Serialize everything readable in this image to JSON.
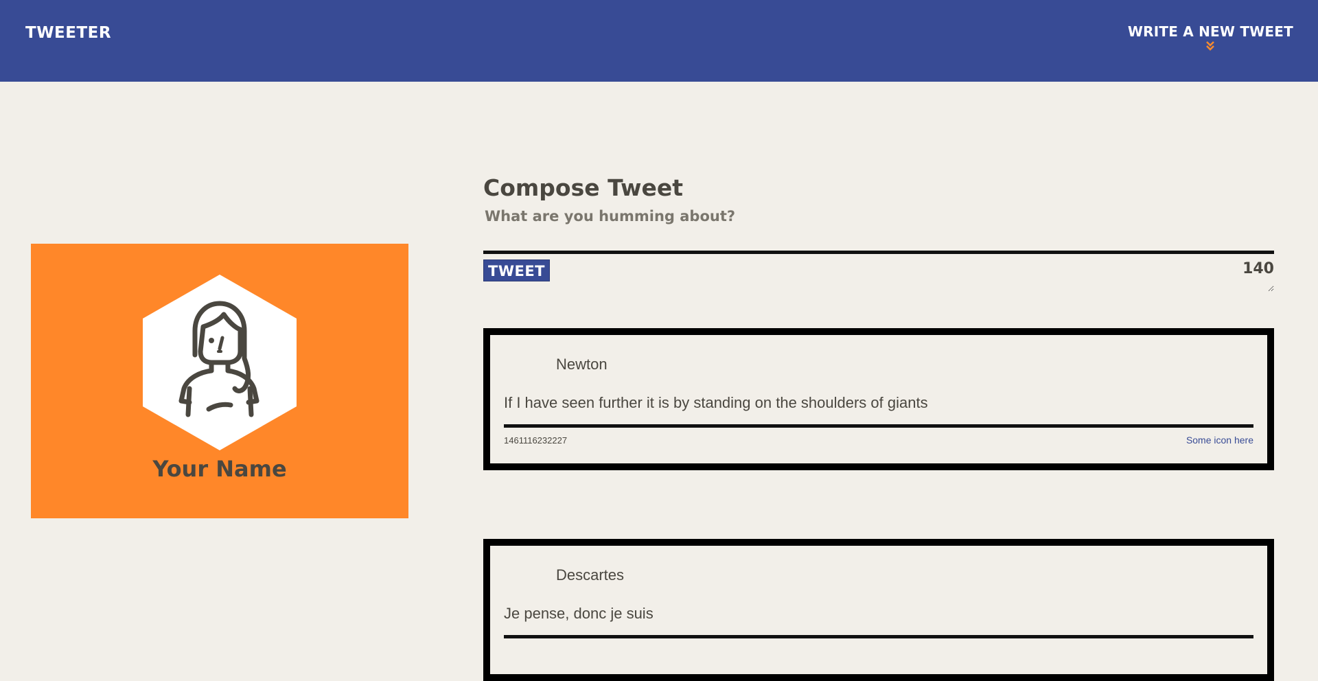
{
  "nav": {
    "brand": "TWEETER",
    "compose_toggle_label": "WRITE A NEW TWEET",
    "compose_toggle_icon": "double-chevron-down-icon"
  },
  "profile": {
    "name": "Your Name",
    "avatar_icon": "female-user-avatar-icon"
  },
  "compose": {
    "title": "Compose Tweet",
    "subtitle": "What are you humming about?",
    "input_value": "",
    "submit_label": "TWEET",
    "char_count": "140"
  },
  "tweets": [
    {
      "author": "Newton",
      "content": "If I have seen further it is by standing on the shoulders of giants",
      "timestamp": "1461116232227",
      "icon_link": "Some icon here"
    },
    {
      "author": "Descartes",
      "content": "Je pense, donc je suis"
    }
  ],
  "colors": {
    "nav_bg": "#384b95",
    "page_bg": "#f2efe9",
    "profile_bg": "#ff8729",
    "accent_orange": "#f58a2e",
    "text_dark": "#4a4740"
  }
}
